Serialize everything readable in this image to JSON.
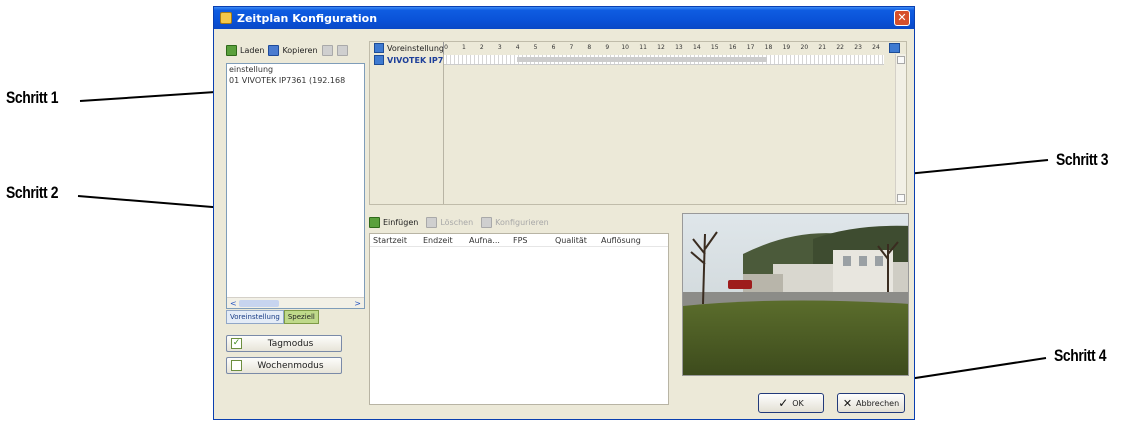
{
  "window": {
    "title": "Zeitplan Konfiguration",
    "close_glyph": "✕"
  },
  "left_toolbar": {
    "laden_label": "Laden",
    "kopieren_label": "Kopieren"
  },
  "schedule_list": {
    "items": [
      "einstellung",
      "01 VIVOTEK IP7361 (192.168"
    ]
  },
  "scroll": {
    "left": "<",
    "right": ">"
  },
  "tabs": [
    {
      "label": "Voreinstellung",
      "active": false
    },
    {
      "label": "Speziell",
      "active": true
    }
  ],
  "modes": {
    "tagmodus": {
      "label": "Tagmodus",
      "checked": true,
      "check_glyph": "✓"
    },
    "wochenmodus": {
      "label": "Wochenmodus",
      "checked": false,
      "check_glyph": ""
    }
  },
  "timeline": {
    "header_label": "Voreinstellung",
    "hours": [
      "0",
      "1",
      "2",
      "3",
      "4",
      "5",
      "6",
      "7",
      "8",
      "9",
      "10",
      "11",
      "12",
      "13",
      "14",
      "15",
      "16",
      "17",
      "18",
      "19",
      "20",
      "21",
      "22",
      "23",
      "24"
    ],
    "rows": [
      {
        "name": "VIVOTEK IP7"
      }
    ]
  },
  "recording_toolbar": {
    "einfuegen": "Einfügen",
    "loeschen": "Löschen",
    "konfigurieren": "Konfigurieren"
  },
  "record_table": {
    "columns": [
      "Startzeit",
      "Endzeit",
      "Aufna...",
      "FPS",
      "Qualität",
      "Auflösung"
    ]
  },
  "buttons": {
    "ok": "OK",
    "abbrechen": "Abbrechen"
  },
  "callouts": {
    "step1": "Schritt 1",
    "step2": "Schritt 2",
    "step3": "Schritt 3",
    "step4": "Schritt 4"
  },
  "colors": {
    "titlebar": "#0a52d8",
    "window_bg": "#ece9d8",
    "tab_active": "#bfd98a",
    "check_green": "#3e8a1c"
  }
}
